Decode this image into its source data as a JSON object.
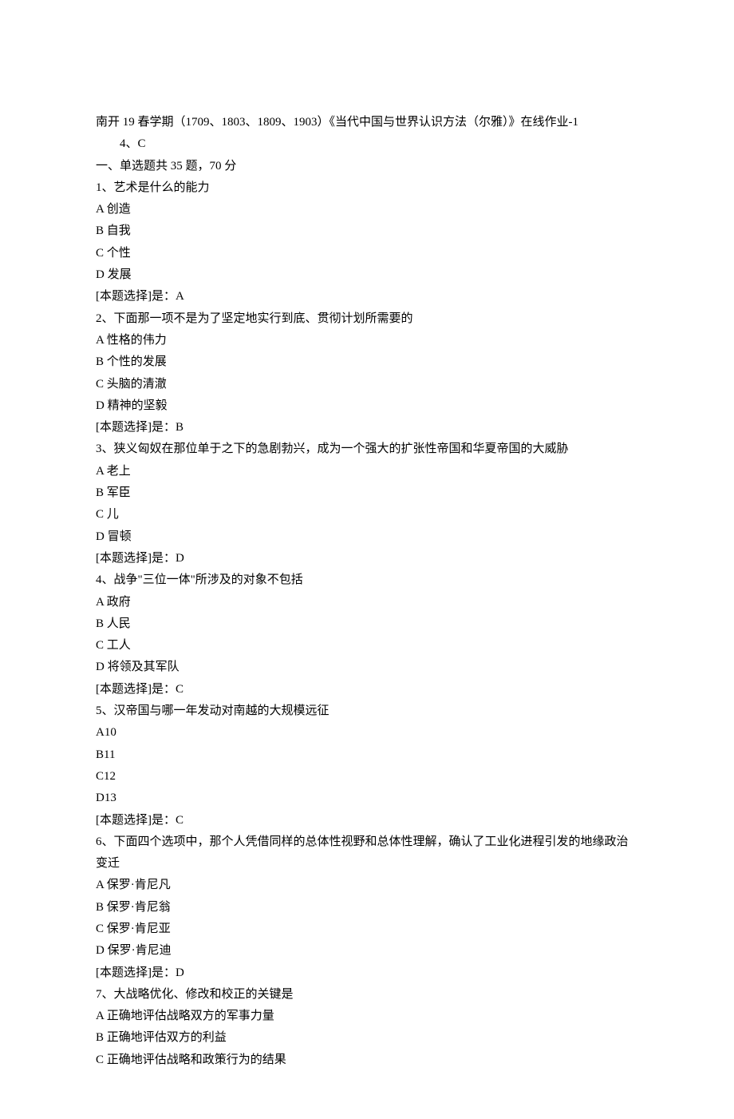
{
  "doc": {
    "course_title": "南开 19 春学期（1709、1803、1809、1903）《当代中国与世界认识方法（尔雅）》在线作业-1",
    "meta_line": "4、C",
    "section_header": "一、单选题共 35 题，70 分",
    "answer_label": "[本题选择]是：",
    "questions": [
      {
        "num": "1",
        "stem": "艺术是什么的能力",
        "options": [
          {
            "letter": "A",
            "text": "创造"
          },
          {
            "letter": "B",
            "text": "自我"
          },
          {
            "letter": "C",
            "text": "个性"
          },
          {
            "letter": "D",
            "text": "发展"
          }
        ],
        "answer": "A"
      },
      {
        "num": "2",
        "stem": "下面那一项不是为了坚定地实行到底、贯彻计划所需要的",
        "options": [
          {
            "letter": "A",
            "text": "性格的伟力"
          },
          {
            "letter": "B",
            "text": "个性的发展"
          },
          {
            "letter": "C",
            "text": "头脑的清澈"
          },
          {
            "letter": "D",
            "text": "精神的坚毅"
          }
        ],
        "answer": "B"
      },
      {
        "num": "3",
        "stem": "狭义匈奴在那位单于之下的急剧勃兴，成为一个强大的扩张性帝国和华夏帝国的大威胁",
        "options": [
          {
            "letter": "A",
            "text": "老上"
          },
          {
            "letter": "B",
            "text": "军臣"
          },
          {
            "letter": "C",
            "text": "儿"
          },
          {
            "letter": "D",
            "text": "冒顿"
          }
        ],
        "answer": "D"
      },
      {
        "num": "4",
        "stem": "战争\"三位一体\"所涉及的对象不包括",
        "options": [
          {
            "letter": "A",
            "text": "政府"
          },
          {
            "letter": "B",
            "text": "人民"
          },
          {
            "letter": "C",
            "text": "工人"
          },
          {
            "letter": "D",
            "text": "将领及其军队"
          }
        ],
        "answer": "C"
      },
      {
        "num": "5",
        "stem": "汉帝国与哪一年发动对南越的大规模远征",
        "options": [
          {
            "letter": "A",
            "text": "10"
          },
          {
            "letter": "B",
            "text": "11"
          },
          {
            "letter": "C",
            "text": "12"
          },
          {
            "letter": "D",
            "text": "13"
          }
        ],
        "answer": "C"
      },
      {
        "num": "6",
        "stem": "下面四个选项中，那个人凭借同样的总体性视野和总体性理解，确认了工业化进程引发的地缘政治变迁",
        "options": [
          {
            "letter": "A",
            "text": "保罗·肯尼凡"
          },
          {
            "letter": "B",
            "text": "保罗·肯尼翁"
          },
          {
            "letter": "C",
            "text": "保罗·肯尼亚"
          },
          {
            "letter": "D",
            "text": "保罗·肯尼迪"
          }
        ],
        "answer": "D"
      },
      {
        "num": "7",
        "stem": "大战略优化、修改和校正的关键是",
        "options": [
          {
            "letter": "A",
            "text": "正确地评估战略双方的军事力量"
          },
          {
            "letter": "B",
            "text": "正确地评估双方的利益"
          },
          {
            "letter": "C",
            "text": "正确地评估战略和政策行为的结果"
          }
        ],
        "answer": null
      }
    ]
  }
}
